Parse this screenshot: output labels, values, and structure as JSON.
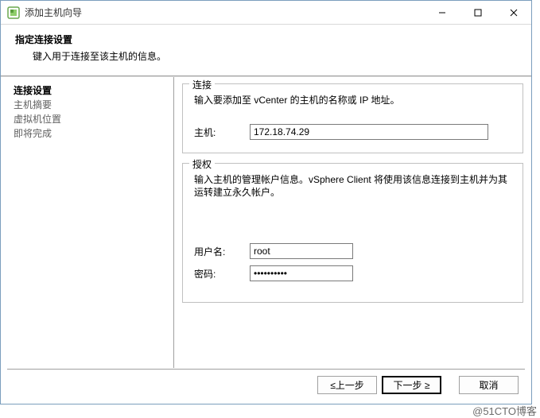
{
  "window": {
    "title": "添加主机向导"
  },
  "header": {
    "title": "指定连接设置",
    "subtitle": "键入用于连接至该主机的信息。"
  },
  "sidebar": {
    "steps": [
      {
        "label": "连接设置",
        "active": true
      },
      {
        "label": "主机摘要",
        "active": false
      },
      {
        "label": "虚拟机位置",
        "active": false
      },
      {
        "label": "即将完成",
        "active": false
      }
    ]
  },
  "connection_group": {
    "legend": "连接",
    "desc": "输入要添加至 vCenter 的主机的名称或 IP 地址。",
    "host_label": "主机:",
    "host_value": "172.18.74.29"
  },
  "auth_group": {
    "legend": "授权",
    "desc": "输入主机的管理帐户信息。vSphere Client 将使用该信息连接到主机并为其运转建立永久帐户。",
    "user_label": "用户名:",
    "user_value": "root",
    "pass_label": "密码:",
    "pass_value": "**********"
  },
  "buttons": {
    "back": "≤上一步",
    "next": "下一步 ≥",
    "cancel": "取消"
  },
  "watermark": "@51CTO博客"
}
